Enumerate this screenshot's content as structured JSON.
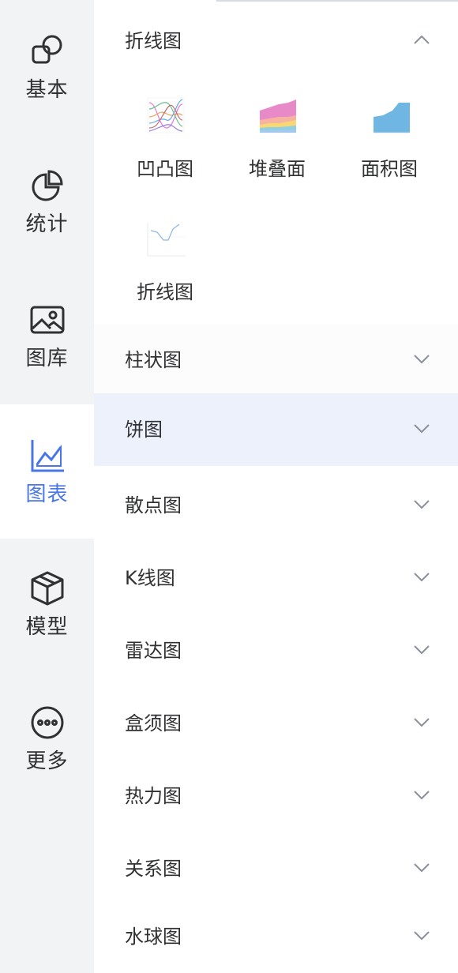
{
  "rail": {
    "items": [
      {
        "label": "基本",
        "icon": "shapes-icon"
      },
      {
        "label": "统计",
        "icon": "pie-chart-icon"
      },
      {
        "label": "图库",
        "icon": "image-icon"
      },
      {
        "label": "图表",
        "icon": "line-chart-icon",
        "active": true
      },
      {
        "label": "模型",
        "icon": "cube-icon"
      },
      {
        "label": "更多",
        "icon": "more-icon"
      }
    ],
    "active_color": "#4876e6"
  },
  "panel": {
    "expanded_section": {
      "title": "折线图",
      "icon": "chevron-up-icon",
      "charts": [
        {
          "label": "凹凸图",
          "icon": "bump-chart-thumbnail"
        },
        {
          "label": "堆叠面",
          "icon": "stacked-area-thumbnail"
        },
        {
          "label": "面积图",
          "icon": "area-chart-thumbnail"
        },
        {
          "label": "折线图",
          "icon": "line-chart-thumbnail"
        }
      ]
    },
    "sections": [
      {
        "title": "柱状图"
      },
      {
        "title": "饼图",
        "highlighted": true
      },
      {
        "title": "散点图"
      },
      {
        "title": "K线图"
      },
      {
        "title": "雷达图"
      },
      {
        "title": "盒须图"
      },
      {
        "title": "热力图"
      },
      {
        "title": "关系图"
      },
      {
        "title": "水球图"
      }
    ],
    "highlight_color": "#ecf1fc"
  }
}
